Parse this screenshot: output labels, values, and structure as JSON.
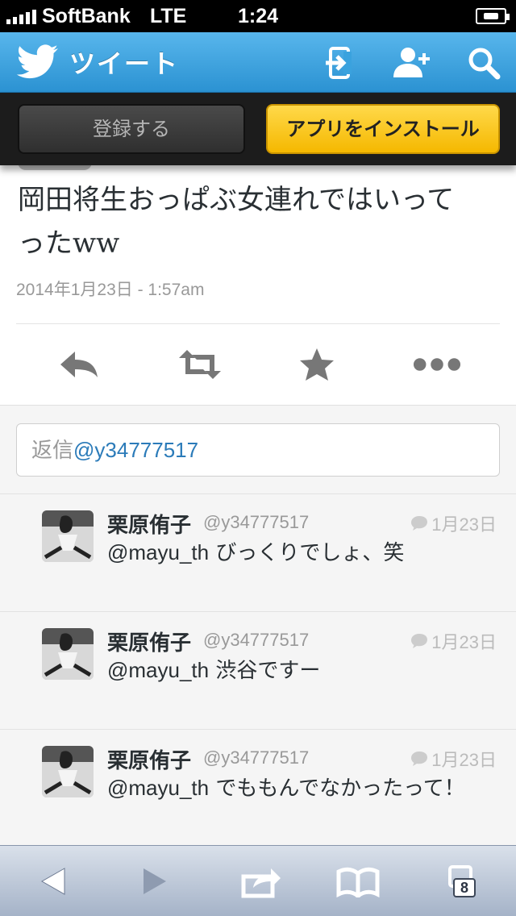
{
  "status_bar": {
    "carrier": "SoftBank",
    "network": "LTE",
    "time": "1:24"
  },
  "header": {
    "title": "ツイート",
    "icons": [
      "twitter-bird-icon",
      "sign-in-icon",
      "add-user-icon",
      "search-icon"
    ]
  },
  "app_banner": {
    "register_label": "登録する",
    "install_label": "アプリをインストール"
  },
  "tweet": {
    "text_line1": "岡田将生おっぱぶ女連れではいって",
    "text_line2": "ったww",
    "date": "2014年1月23日 - 1:57am",
    "actions": [
      "reply-icon",
      "retweet-icon",
      "favorite-icon",
      "more-icon"
    ]
  },
  "reply_box": {
    "prefix": "返信",
    "handle": "@y34777517"
  },
  "replies": [
    {
      "name": "栗原侑子",
      "handle": "@y34777517",
      "time": "1月23日",
      "mention": "@mayu_th",
      "text": "びっくりでしょ、笑"
    },
    {
      "name": "栗原侑子",
      "handle": "@y34777517",
      "time": "1月23日",
      "mention": "@mayu_th",
      "text": "渋谷ですー"
    },
    {
      "name": "栗原侑子",
      "handle": "@y34777517",
      "time": "1月23日",
      "mention": "@mayu_th",
      "text": "でももんでなかったって！"
    }
  ],
  "browser_toolbar": {
    "tab_count": "8",
    "icons": [
      "back-icon",
      "forward-icon",
      "share-icon",
      "bookmarks-icon",
      "tabs-icon"
    ]
  },
  "colors": {
    "header_blue": "#2b92d2",
    "install_yellow": "#f5b800",
    "link_blue": "#2b7bb9"
  }
}
